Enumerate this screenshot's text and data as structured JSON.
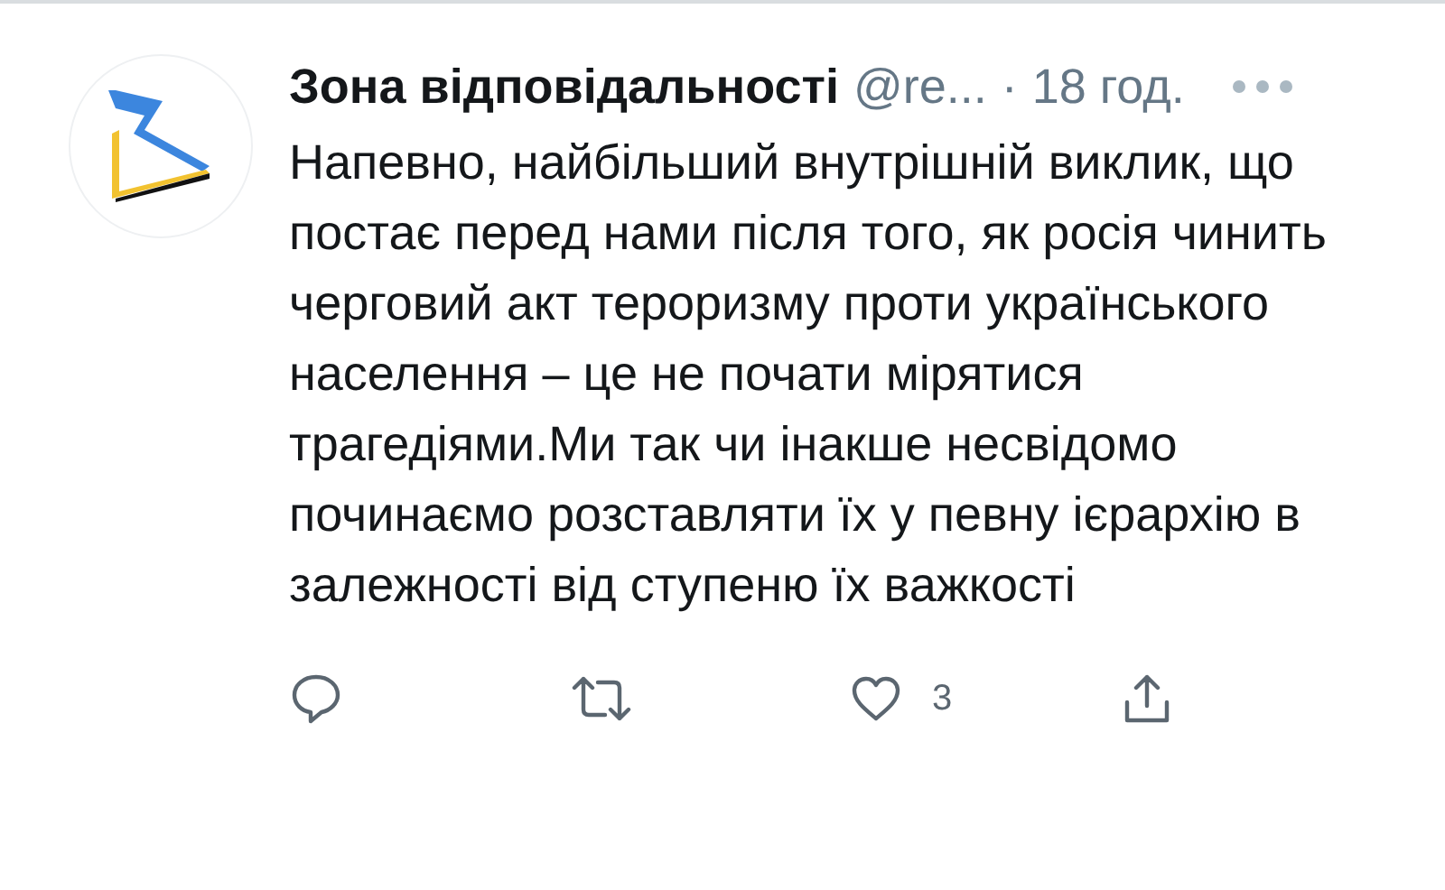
{
  "tweet": {
    "author": "Зона відповідальності",
    "handle": "@re...",
    "separator": "·",
    "time": "18 год.",
    "text": "Напевно, найбільший внутрішній виклик, що постає перед нами після того, як росія чинить черговий акт тероризму проти українського населення – це не почати мірятися трагедіями.Ми так чи інакше несвідомо починаємо розставляти їх у певну ієрархію в залежності від ступеню їх важкості"
  },
  "actions": [
    {
      "kind": "reply"
    },
    {
      "kind": "retweet"
    },
    {
      "kind": "like",
      "count": "3"
    },
    {
      "kind": "share"
    }
  ]
}
